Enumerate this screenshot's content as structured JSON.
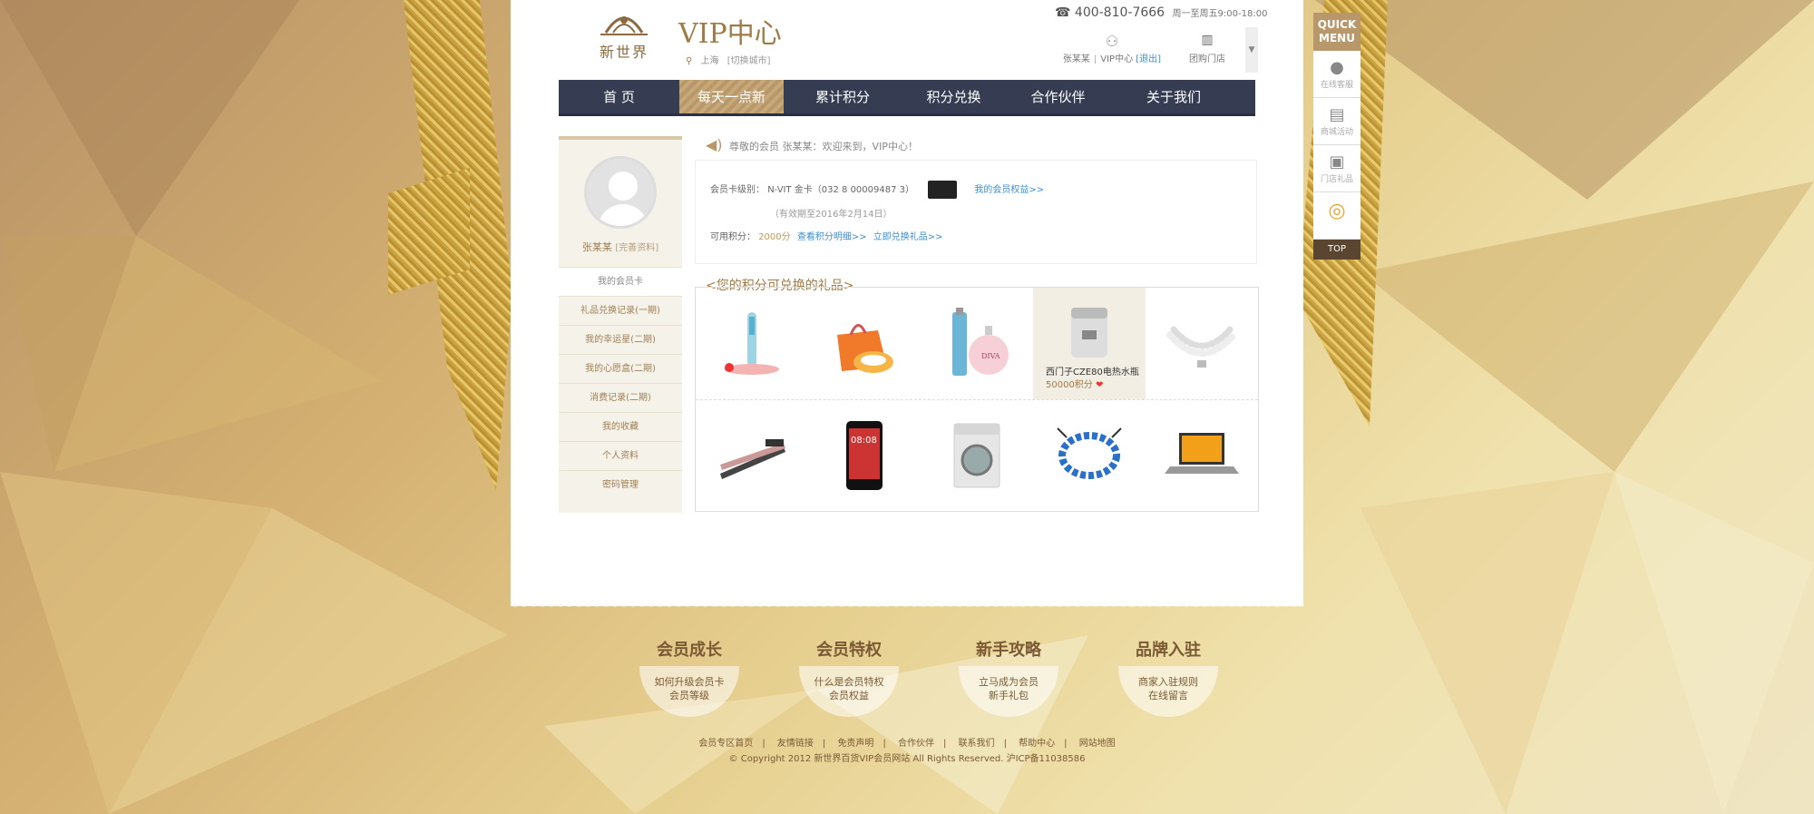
{
  "header": {
    "logo_text": "新世界",
    "vip_title": "VIP中心",
    "location": "上海",
    "location_switch": "[切换城市]",
    "hotline": "400-810-7666",
    "hotline_hours": "周一至周五9:00-18:00",
    "user_name": "张某某",
    "vip_center": "VIP中心",
    "logout": "[退出]",
    "stores": "团购门店"
  },
  "nav": {
    "items": [
      "首 页",
      "每天一点新",
      "累计积分",
      "积分兑换",
      "合作伙伴",
      "关于我们"
    ],
    "active_index": 1
  },
  "sidebar": {
    "user_name": "张某某",
    "complete_profile": "[完善资料]",
    "items": [
      "我的会员卡",
      "礼品兑换记录(一期)",
      "我的幸运星(二期)",
      "我的心愿盒(二期)",
      "消费记录(二期)",
      "我的收藏",
      "个人资料",
      "密码管理"
    ],
    "active_index": 0
  },
  "welcome": "尊敬的会员 张某某：欢迎来到，VIP中心！",
  "member": {
    "level_label": "会员卡级别：",
    "level_value": "N-VIT 金卡（032 8 00009487 3）",
    "upgrade_link": "我的会员权益>>",
    "valid_until": "（有效期至2016年2月14日）",
    "points_label": "可用积分：",
    "points_value": "2000分",
    "points_detail_link": "查看积分明细>>",
    "redeem_link": "立即兑换礼品>>"
  },
  "gifts": {
    "title": "<您的积分可兑换的礼品>",
    "items": [
      {
        "name": "electric-toothbrush"
      },
      {
        "name": "orange-bag-set"
      },
      {
        "name": "perfume-set"
      },
      {
        "name": "water-heater",
        "caption": "西门子CZE80电热水瓶",
        "points": "50000积分"
      },
      {
        "name": "pearl-necklace"
      },
      {
        "name": "hair-straightener"
      },
      {
        "name": "smartphone"
      },
      {
        "name": "washing-machine"
      },
      {
        "name": "crystal-bracelet"
      },
      {
        "name": "laptop"
      }
    ]
  },
  "quick_menu": {
    "title_1": "QUICK",
    "title_2": "MENU",
    "items": [
      {
        "label": "在线客服",
        "icon": "person-icon"
      },
      {
        "label": "商城活动",
        "icon": "newspaper-icon"
      },
      {
        "label": "门店礼品",
        "icon": "gift-box-icon"
      },
      {
        "label": "",
        "icon": "weibo-icon"
      }
    ],
    "top": "TOP"
  },
  "footer": {
    "blocks": [
      {
        "title": "会员成长",
        "line1": "如何升级会员卡",
        "line2": "会员等级"
      },
      {
        "title": "会员特权",
        "line1": "什么是会员特权",
        "line2": "会员权益"
      },
      {
        "title": "新手攻略",
        "line1": "立马成为会员",
        "line2": "新手礼包"
      },
      {
        "title": "品牌入驻",
        "line1": "商家入驻规则",
        "line2": "在线留言"
      }
    ],
    "links": [
      "会员专区首页",
      "友情链接",
      "免责声明",
      "合作伙伴",
      "联系我们",
      "帮助中心",
      "网站地图"
    ],
    "copyright": "© Copyright 2012 新世界百货VIP会员网站 All Rights Reserved. 沪ICP备11038586"
  }
}
